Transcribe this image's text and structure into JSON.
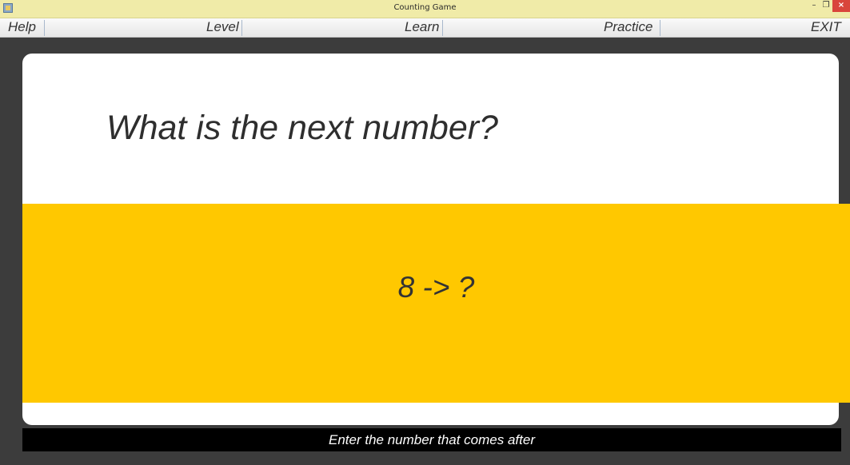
{
  "window": {
    "title": "Counting Game",
    "minimize_symbol": "–",
    "maximize_symbol": "❐",
    "close_symbol": "×"
  },
  "menu": {
    "items": [
      {
        "label": "Help"
      },
      {
        "label": "Level"
      },
      {
        "label": "Learn"
      },
      {
        "label": "Practice"
      },
      {
        "label": "EXIT"
      }
    ]
  },
  "game": {
    "question": "What is the next number?",
    "prompt": "8 -> ?",
    "status": "Enter the number that comes after"
  },
  "colors": {
    "titlebar": "#f0eba8",
    "background": "#3c3c3c",
    "card": "#ffffff",
    "answer_panel": "#ffc800",
    "statusbar": "#000000"
  }
}
